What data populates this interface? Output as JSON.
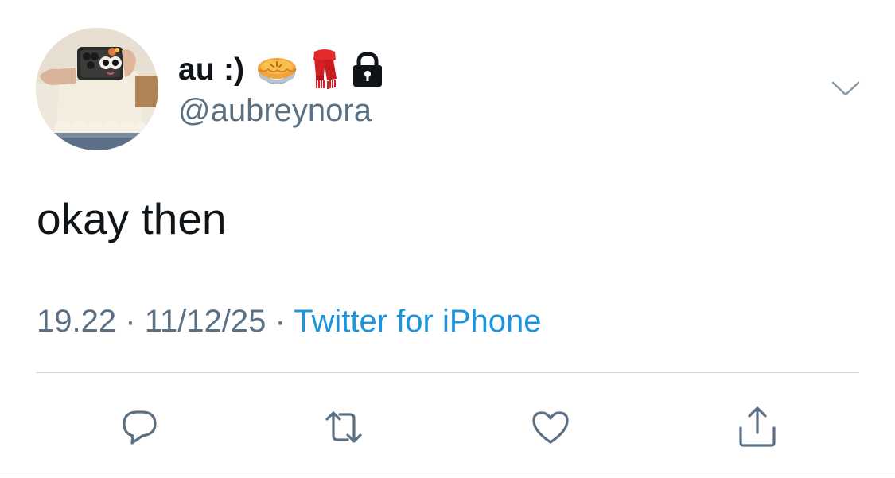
{
  "tweet": {
    "display_name": "au :)",
    "name_emojis": [
      "pie-icon",
      "scarf-icon",
      "lock-icon"
    ],
    "handle": "@aubreynora",
    "text": "okay then",
    "time": "19.22",
    "date": "11/12/25",
    "separator": "·",
    "source": "Twitter for iPhone"
  },
  "actions": [
    {
      "name": "reply-icon"
    },
    {
      "name": "retweet-icon"
    },
    {
      "name": "like-icon"
    },
    {
      "name": "share-icon"
    }
  ],
  "colors": {
    "text": "#0f1419",
    "secondary": "#5b7083",
    "link": "#1b95e0",
    "divider": "#d3d9de"
  }
}
